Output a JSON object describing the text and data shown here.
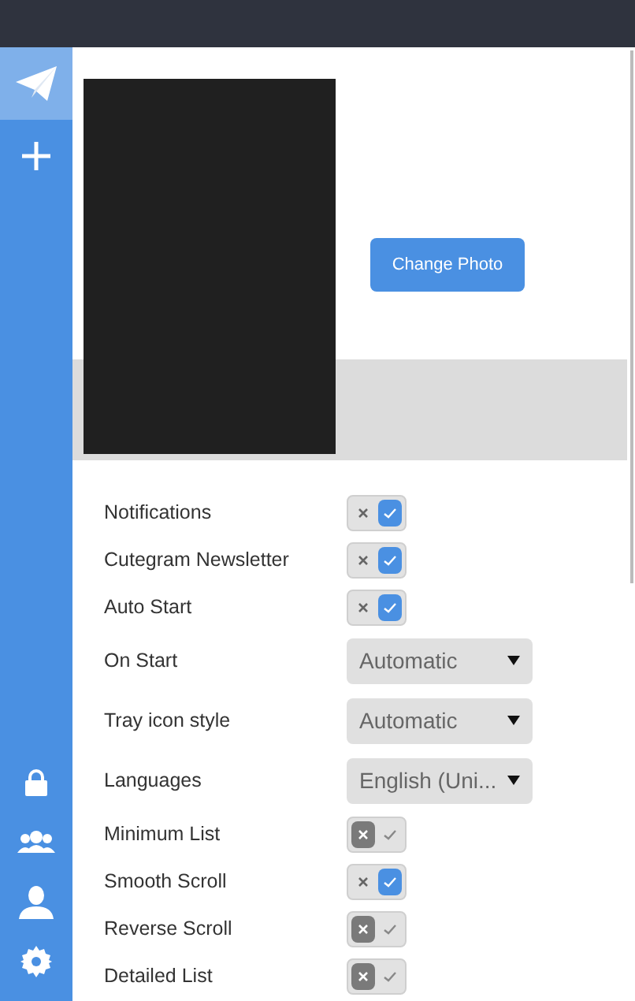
{
  "sidebar": {
    "items": [
      {
        "kind": "plane",
        "selected": true
      },
      {
        "kind": "plus",
        "selected": false
      }
    ],
    "bottom_items": [
      {
        "kind": "lock"
      },
      {
        "kind": "contacts"
      },
      {
        "kind": "profile"
      },
      {
        "kind": "settings"
      }
    ]
  },
  "profile": {
    "change_photo_button": "Change Photo"
  },
  "settings": [
    {
      "kind": "toggle",
      "label": "Notifications",
      "on": true
    },
    {
      "kind": "toggle",
      "label": "Cutegram Newsletter",
      "on": true
    },
    {
      "kind": "toggle",
      "label": "Auto Start",
      "on": true
    },
    {
      "kind": "select",
      "label": "On Start",
      "value": "Automatic"
    },
    {
      "kind": "select",
      "label": "Tray icon style",
      "value": "Automatic"
    },
    {
      "kind": "select",
      "label": "Languages",
      "value": "English (Uni..."
    },
    {
      "kind": "toggle",
      "label": "Minimum List",
      "on": false
    },
    {
      "kind": "toggle",
      "label": "Smooth Scroll",
      "on": true
    },
    {
      "kind": "toggle",
      "label": "Reverse Scroll",
      "on": false
    },
    {
      "kind": "toggle",
      "label": "Detailed List",
      "on": false
    }
  ]
}
